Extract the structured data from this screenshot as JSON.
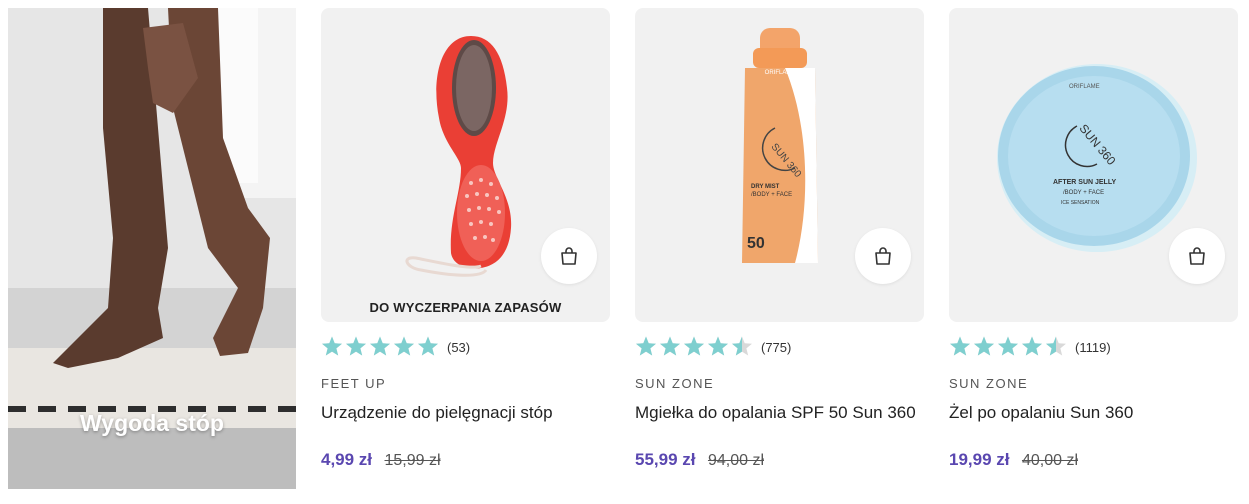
{
  "promo": {
    "title": "Wygoda stóp"
  },
  "products": [
    {
      "badge": "DO WYCZERPANIA ZAPASÓW",
      "rating": 5,
      "review_count": "(53)",
      "brand": "FEET UP",
      "name": "Urządzenie do pielęgnacji stóp",
      "price": "4,99 zł",
      "old_price": "15,99 zł",
      "image_icon": "foot-brush-image"
    },
    {
      "badge": "",
      "rating": 4.5,
      "review_count": "(775)",
      "brand": "SUN ZONE",
      "name": "Mgiełka do opalania SPF 50 Sun 360",
      "price": "55,99 zł",
      "old_price": "94,00 zł",
      "image_icon": "sun-spray-image",
      "pack_logo": "ORIFLAME",
      "pack_title": "SUN 360",
      "pack_sub": "DRY MIST",
      "pack_sub2": "/BODY + FACE",
      "pack_spf": "50"
    },
    {
      "badge": "",
      "rating": 4.5,
      "review_count": "(1119)",
      "brand": "SUN ZONE",
      "name": "Żel po opalaniu Sun 360",
      "price": "19,99 zł",
      "old_price": "40,00 zł",
      "image_icon": "after-sun-jelly-image",
      "pack_logo": "ORIFLAME",
      "pack_title": "SUN 360",
      "pack_sub": "AFTER SUN JELLY",
      "pack_sub2": "/BODY + FACE",
      "pack_sub3": "ICE SENSATION"
    }
  ],
  "colors": {
    "star": "#7ecfcf",
    "star_empty": "#d9d9d9",
    "price": "#5a47b0"
  },
  "icons": {
    "cart": "shopping-bag-icon",
    "star": "star-icon"
  }
}
